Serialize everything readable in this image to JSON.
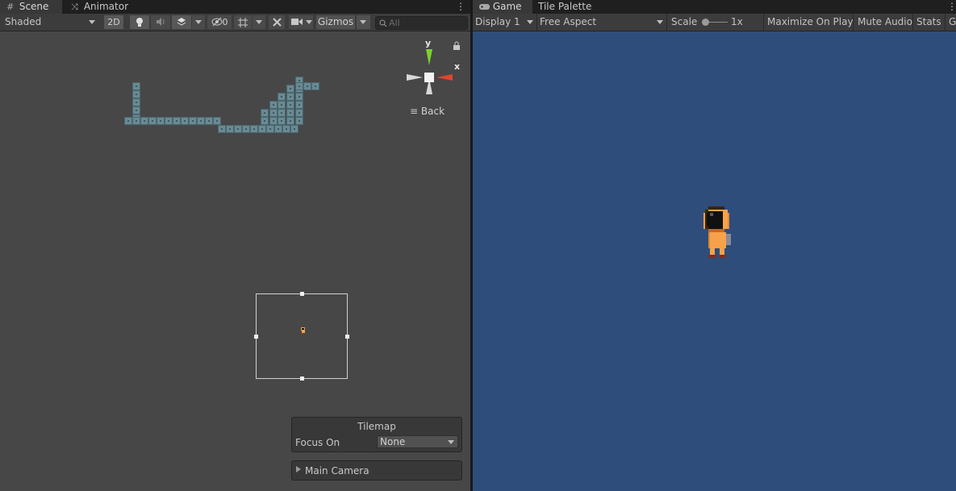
{
  "scene_panel": {
    "tabs": [
      {
        "label": "Scene",
        "icon": "hash-icon"
      },
      {
        "label": "Animator",
        "icon": "animator-icon"
      }
    ],
    "toolbar": {
      "shading_mode": "Shaded",
      "mode_2d_label": "2D",
      "hidden_count": "0",
      "gizmos_label": "Gizmos",
      "search_placeholder": "All"
    },
    "gizmo": {
      "y_label": "y",
      "x_label": "x",
      "back_label": "Back"
    },
    "tilemap_overlay": {
      "title": "Tilemap",
      "focus_label": "Focus On",
      "focus_value": "None"
    },
    "camera_overlay": {
      "label": "Main Camera"
    }
  },
  "game_panel": {
    "tabs": [
      {
        "label": "Game",
        "icon": "gamepad-icon"
      },
      {
        "label": "Tile Palette",
        "icon": ""
      }
    ],
    "toolbar": {
      "display": "Display 1",
      "aspect": "Free Aspect",
      "scale_label": "Scale",
      "scale_value": "1x",
      "maximize_label": "Maximize On Play",
      "mute_label": "Mute Audio",
      "stats_label": "Stats",
      "gizmos_cut_label": "G"
    }
  },
  "colors": {
    "editor_dark": "#1f1f1f",
    "scene_bg": "#474747",
    "game_bg": "#2f4d7b",
    "tile": "#6a8a93",
    "gizmo_x": "#e0452d",
    "gizmo_y": "#7bd130",
    "character_orange": "#f5a24a"
  }
}
